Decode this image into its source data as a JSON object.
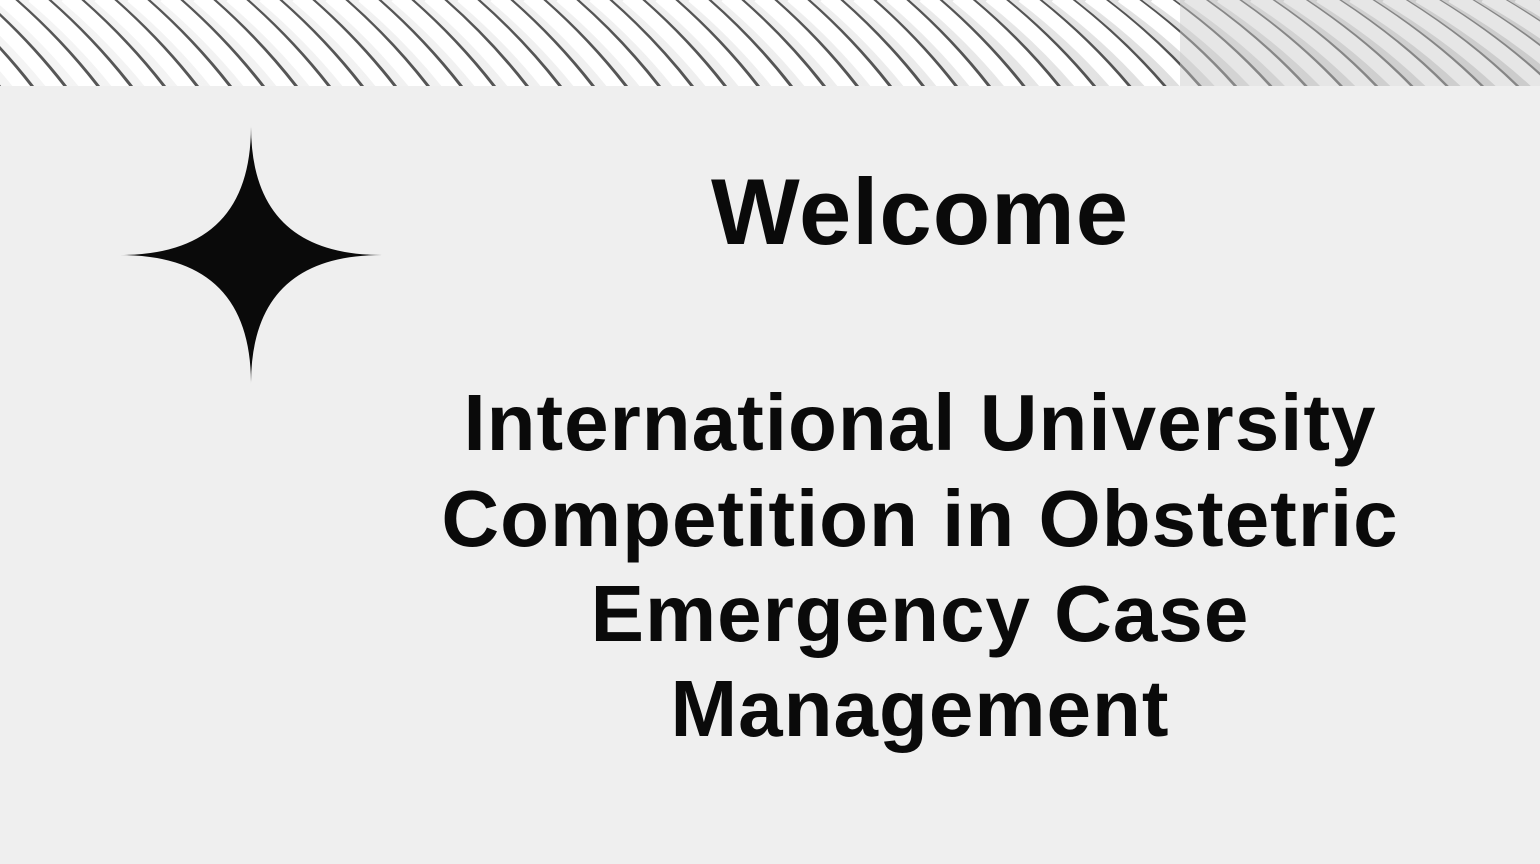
{
  "banner": {
    "icon": "diagonal-stripes-pattern"
  },
  "decoration": {
    "icon": "four-point-star-icon",
    "color": "#0a0a0a"
  },
  "heading": {
    "welcome": "Welcome"
  },
  "title": {
    "lines": [
      "International University",
      "Competition in Obstetric",
      "Emergency Case",
      "Management"
    ]
  },
  "colors": {
    "background": "#efefef",
    "text": "#0a0a0a"
  }
}
